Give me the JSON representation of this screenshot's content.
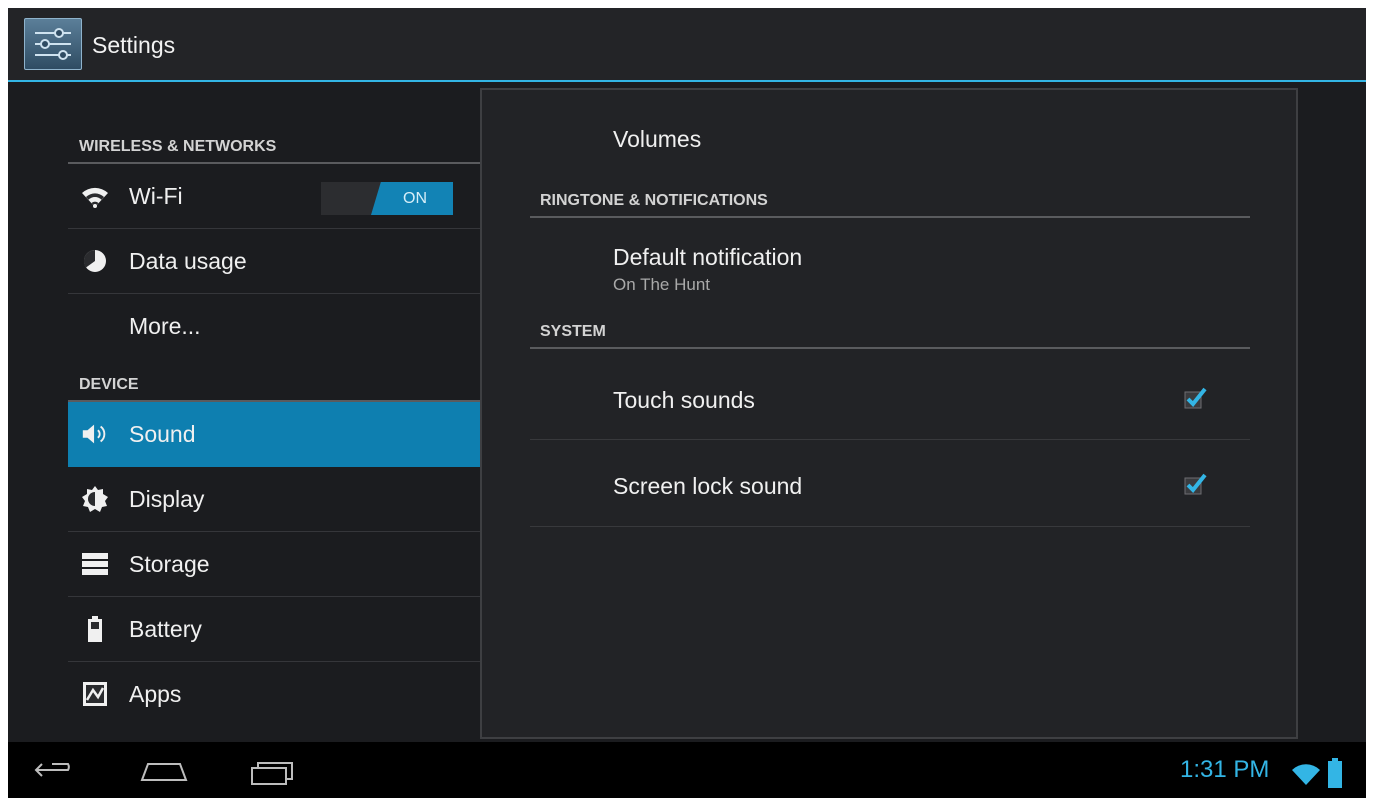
{
  "actionbar": {
    "title": "Settings",
    "icon": "settings-icon"
  },
  "sidebar": {
    "sections": [
      {
        "header": "WIRELESS & NETWORKS"
      },
      {
        "header": "DEVICE"
      }
    ],
    "items": [
      {
        "label": "Wi-Fi",
        "icon": "wifi-icon",
        "toggle": "ON"
      },
      {
        "label": "Data usage",
        "icon": "data-usage-icon"
      },
      {
        "label": "More..."
      },
      {
        "label": "Sound",
        "icon": "sound-icon",
        "selected": true
      },
      {
        "label": "Display",
        "icon": "display-icon"
      },
      {
        "label": "Storage",
        "icon": "storage-icon"
      },
      {
        "label": "Battery",
        "icon": "battery-icon"
      },
      {
        "label": "Apps",
        "icon": "apps-icon"
      }
    ]
  },
  "main": {
    "volumes": "Volumes",
    "ringtone_header": "RINGTONE & NOTIFICATIONS",
    "default_notification": {
      "title": "Default notification",
      "value": "On The Hunt"
    },
    "system_header": "SYSTEM",
    "touch_sounds": {
      "label": "Touch sounds",
      "checked": true
    },
    "screen_lock_sound": {
      "label": "Screen lock sound",
      "checked": true
    }
  },
  "navbar": {
    "time": "1:31 PM",
    "buttons": [
      "back-icon",
      "home-icon",
      "recent-apps-icon"
    ]
  },
  "colors": {
    "accent": "#33b5e5",
    "selected": "#0e7fb0"
  }
}
